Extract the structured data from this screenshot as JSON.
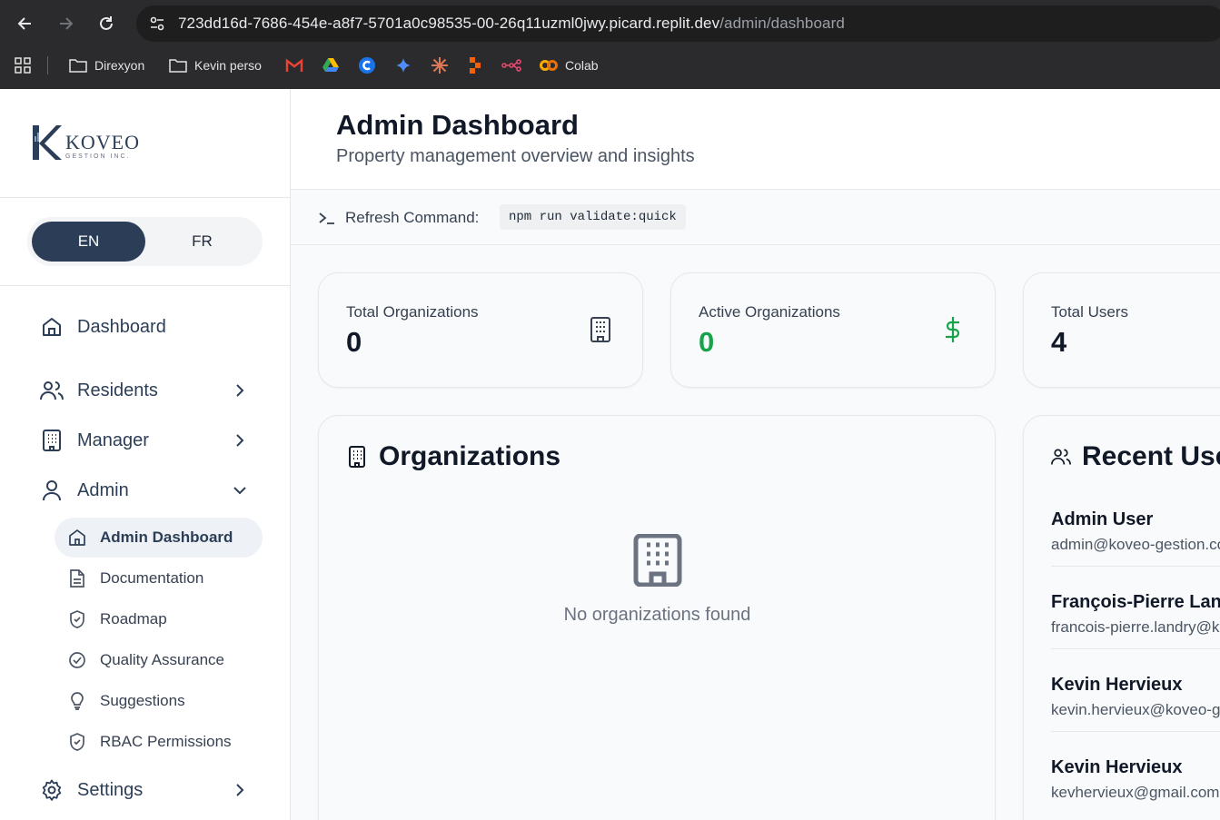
{
  "browser": {
    "url_host": "723dd16d-7686-454e-a8f7-5701a0c98535-00-26q11uzml0jwy.picard.replit.dev",
    "url_path": "/admin/dashboard",
    "bookmarks": [
      {
        "label": "Direxyon",
        "icon": "folder-icon"
      },
      {
        "label": "Kevin perso",
        "icon": "folder-icon"
      },
      {
        "label": "Colab",
        "icon": "colab-icon"
      }
    ]
  },
  "sidebar": {
    "logo": {
      "brand": "KOVEO",
      "sub": "GESTION INC."
    },
    "lang": {
      "en": "EN",
      "fr": "FR",
      "active": "EN"
    },
    "nav": [
      {
        "label": "Dashboard",
        "icon": "home-icon"
      },
      {
        "label": "Residents",
        "icon": "users-icon"
      },
      {
        "label": "Manager",
        "icon": "building-icon"
      },
      {
        "label": "Admin",
        "icon": "user-icon"
      },
      {
        "label": "Settings",
        "icon": "gear-icon"
      }
    ],
    "admin_items": [
      {
        "label": "Admin Dashboard",
        "icon": "home-icon"
      },
      {
        "label": "Documentation",
        "icon": "file-icon"
      },
      {
        "label": "Roadmap",
        "icon": "shield-icon"
      },
      {
        "label": "Quality Assurance",
        "icon": "check-circle-icon"
      },
      {
        "label": "Suggestions",
        "icon": "lightbulb-icon"
      },
      {
        "label": "RBAC Permissions",
        "icon": "shield-icon"
      }
    ]
  },
  "header": {
    "title": "Admin Dashboard",
    "subtitle": "Property management overview and insights"
  },
  "command": {
    "label": "Refresh Command:",
    "code": "npm run validate:quick"
  },
  "stats": [
    {
      "label": "Total Organizations",
      "value": "0",
      "icon": "building-icon",
      "color": "#111827"
    },
    {
      "label": "Active Organizations",
      "value": "0",
      "icon": "dollar-icon",
      "color": "#16a34a"
    },
    {
      "label": "Total Users",
      "value": "4",
      "icon": "users-icon",
      "color": "#111827"
    }
  ],
  "organizations": {
    "title": "Organizations",
    "empty": "No organizations found"
  },
  "recent_users": {
    "title": "Recent Users",
    "users": [
      {
        "name": "Admin User",
        "email": "admin@koveo-gestion.com"
      },
      {
        "name": "François-Pierre Landry",
        "email": "francois-pierre.landry@koveo-gestion.com"
      },
      {
        "name": "Kevin Hervieux",
        "email": "kevin.hervieux@koveo-gestion.com"
      },
      {
        "name": "Kevin Hervieux",
        "email": "kevhervieux@gmail.com"
      }
    ]
  },
  "colors": {
    "primary": "#2c3e57",
    "success": "#16a34a"
  }
}
